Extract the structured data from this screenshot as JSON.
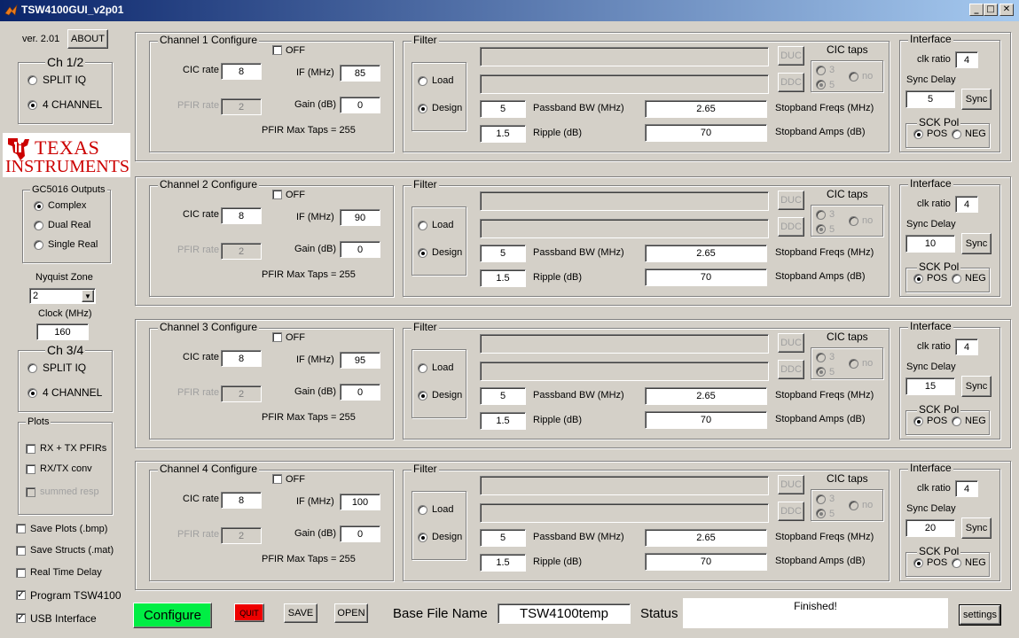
{
  "window": {
    "title": "TSW4100GUI_v2p01",
    "min": "_",
    "max": "□",
    "close": "✕"
  },
  "version": "ver. 2.01",
  "about": "ABOUT",
  "ch12": {
    "title": "Ch 1/2",
    "opt1": "SPLIT IQ",
    "opt2": "4 CHANNEL",
    "selected": "4 CHANNEL"
  },
  "logo": {
    "line1": "TEXAS",
    "line2": "INSTRUMENTS",
    "color": "#cc0000"
  },
  "gc": {
    "title": "GC5016 Outputs",
    "opts": [
      "Complex",
      "Dual Real",
      "Single Real"
    ],
    "selected": "Complex"
  },
  "nyquist": {
    "label": "Nyquist Zone",
    "value": "2"
  },
  "clock": {
    "label": "Clock (MHz)",
    "value": "160"
  },
  "ch34": {
    "title": "Ch 3/4",
    "opt1": "SPLIT IQ",
    "opt2": "4 CHANNEL",
    "selected": "4 CHANNEL"
  },
  "plots": {
    "title": "Plots",
    "items": [
      "RX + TX PFIRs",
      "RX/TX conv",
      "summed resp"
    ]
  },
  "options": [
    {
      "label": "Save Plots (.bmp)",
      "checked": false
    },
    {
      "label": "Save Structs (.mat)",
      "checked": false
    },
    {
      "label": "Real Time Delay",
      "checked": false
    },
    {
      "label": "Program TSW4100",
      "checked": true
    },
    {
      "label": "USB Interface",
      "checked": true
    }
  ],
  "labels": {
    "off": "OFF",
    "cic_rate": "CIC rate",
    "if_mhz": "IF (MHz)",
    "pfir_rate": "PFIR rate",
    "gain": "Gain (dB)",
    "filter": "Filter",
    "load": "Load",
    "design": "Design",
    "duc": "DUC",
    "ddc": "DDC",
    "cic_taps": "CIC taps",
    "tap3": "3",
    "tap5": "5",
    "tapno": "no",
    "passband": "Passband BW (MHz)",
    "ripple": "Ripple (dB)",
    "stop_freqs": "Stopband Freqs (MHz)",
    "stop_amps": "Stopband Amps (dB)",
    "interface": "Interface",
    "clk_ratio": "clk ratio",
    "sync_delay": "Sync Delay",
    "sync": "Sync",
    "sck_pol": "SCK Pol",
    "pos": "POS",
    "neg": "NEG"
  },
  "channels": [
    {
      "title": "Channel 1 Configure",
      "cic_rate": "8",
      "if": "85",
      "pfir_rate": "2",
      "gain": "0",
      "max_taps": "PFIR Max Taps = 255",
      "passband": "5",
      "ripple": "1.5",
      "stop_freqs": "2.65",
      "stop_amps": "70",
      "clk_ratio": "4",
      "sync_delay": "5"
    },
    {
      "title": "Channel 2 Configure",
      "cic_rate": "8",
      "if": "90",
      "pfir_rate": "2",
      "gain": "0",
      "max_taps": "PFIR Max Taps = 255",
      "passband": "5",
      "ripple": "1.5",
      "stop_freqs": "2.65",
      "stop_amps": "70",
      "clk_ratio": "4",
      "sync_delay": "10"
    },
    {
      "title": "Channel 3 Configure",
      "cic_rate": "8",
      "if": "95",
      "pfir_rate": "2",
      "gain": "0",
      "max_taps": "PFIR Max Taps = 255",
      "passband": "5",
      "ripple": "1.5",
      "stop_freqs": "2.65",
      "stop_amps": "70",
      "clk_ratio": "4",
      "sync_delay": "15"
    },
    {
      "title": "Channel 4 Configure",
      "cic_rate": "8",
      "if": "100",
      "pfir_rate": "2",
      "gain": "0",
      "max_taps": "PFIR Max Taps = 255",
      "passband": "5",
      "ripple": "1.5",
      "stop_freqs": "2.65",
      "stop_amps": "70",
      "clk_ratio": "4",
      "sync_delay": "20"
    }
  ],
  "bottom": {
    "configure": "Configure",
    "configure_color": "#00ee44",
    "quit": "QUIT",
    "quit_color": "#ee0000",
    "save": "SAVE",
    "open": "OPEN",
    "base_label": "Base File Name",
    "base_value": "TSW4100temp",
    "status_label": "Status",
    "status_text": "Finished!",
    "settings": "settings"
  }
}
